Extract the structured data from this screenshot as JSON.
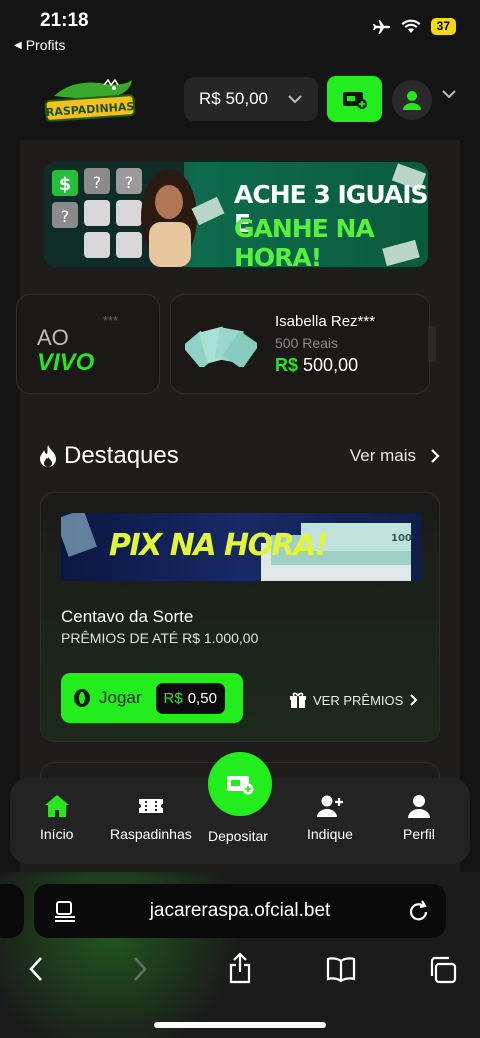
{
  "status": {
    "time": "21:18",
    "back_app": "Profits",
    "battery": "37"
  },
  "header": {
    "logo_text": "RASPADINHAS",
    "balance": "R$ 50,00"
  },
  "banner": {
    "line1": "ACHE 3 IGUAIS E",
    "line2": "GANHE NA HORA!"
  },
  "live": {
    "ao": "AO",
    "vivo": "VIVO",
    "stars": "***",
    "winner_name": "Isabella Rez***",
    "winner_prize": "500 Reais",
    "winner_currency": "R$",
    "winner_amount": "500,00"
  },
  "destaques": {
    "title": "Destaques",
    "see_more": "Ver mais"
  },
  "game": {
    "banner_text": "PIX NA HORA!",
    "title": "Centavo da Sorte",
    "subtitle": "PRÊMIOS DE ATÉ R$ 1.000,00",
    "play_label": "Jogar",
    "price_currency": "R$",
    "price_value": "0,50",
    "prizes_label": "VER PRÊMIOS"
  },
  "nav": {
    "inicio": "Início",
    "raspadinhas": "Raspadinhas",
    "depositar": "Depositar",
    "indique": "Indique",
    "perfil": "Perfil"
  },
  "browser": {
    "url": "jacareraspa.ofcial.bet"
  },
  "colors": {
    "accent_green": "#22ee1e",
    "background": "#141414",
    "panel": "#1e1d1c"
  }
}
